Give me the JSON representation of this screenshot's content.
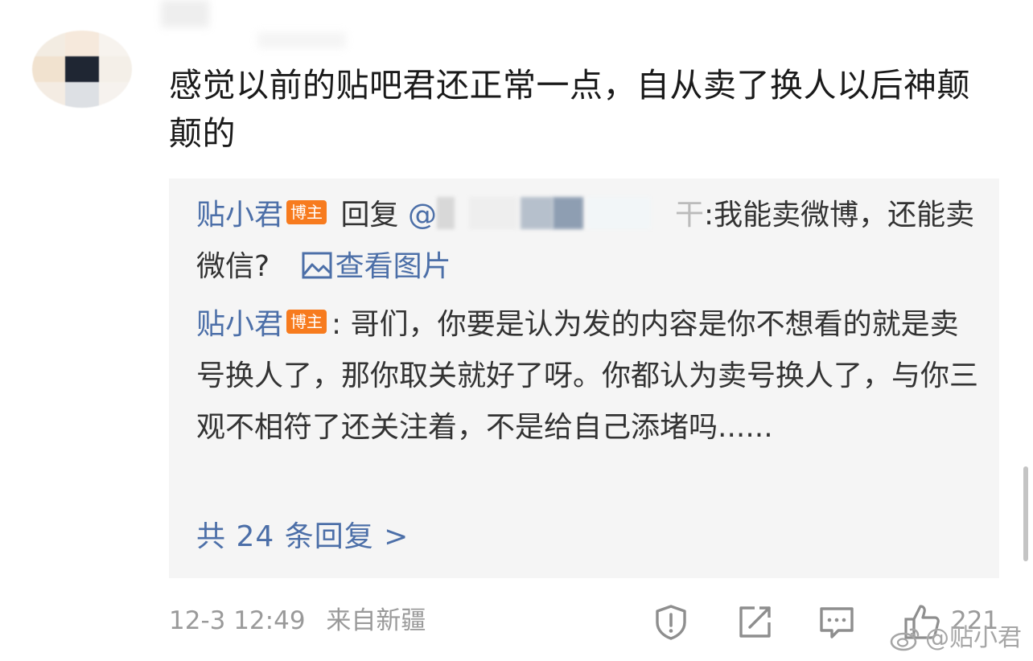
{
  "comment": {
    "text": "感觉以前的贴吧君还正常一点，自从卖了换人以后神颠颠的"
  },
  "replies": [
    {
      "author": "贴小君",
      "badge": "博主",
      "action": "回复",
      "mention_prefix": "@",
      "mention_tail": "干",
      "text": ":我能卖微博，还能卖微信?",
      "view_image": "查看图片"
    },
    {
      "author": "贴小君",
      "badge": "博主",
      "text": ": 哥们，你要是认为发的内容是你不想看的就是卖号换人了，那你取关就好了呀。你都认为卖号换人了，与你三观不相符了还关注着，不是给自己添堵吗......"
    }
  ],
  "more_replies": "共 24 条回复 >",
  "meta": {
    "time": "12-3 12:49",
    "location": "来自新疆"
  },
  "actions": {
    "like_count": "221"
  },
  "watermark": "@贴小君",
  "colors": {
    "link": "#4c6fa8",
    "badge": "#f77b1e",
    "reply_bg": "#f5f5f5",
    "meta": "#9a9a9a"
  },
  "icons": [
    "report-icon",
    "share-icon",
    "comment-icon",
    "like-icon",
    "image-icon",
    "weibo-logo-icon"
  ]
}
